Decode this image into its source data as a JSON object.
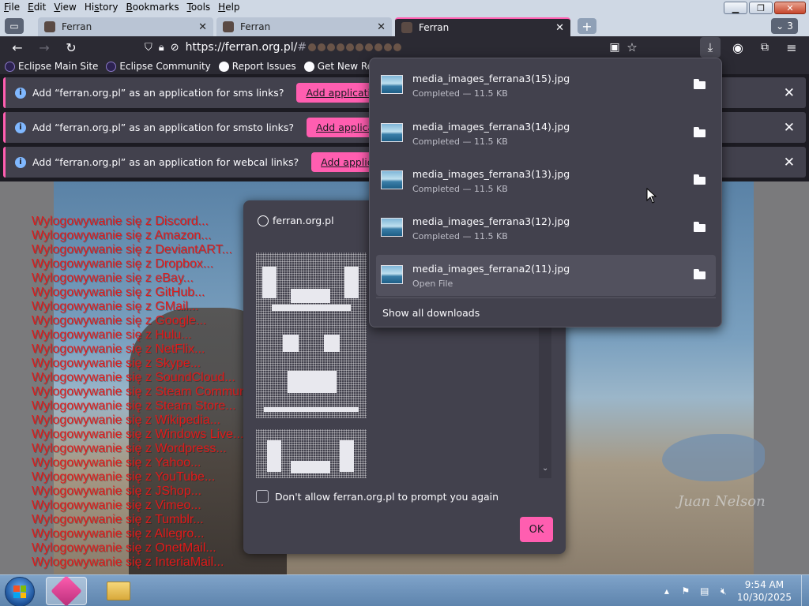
{
  "menubar": [
    {
      "pre": "",
      "u": "F",
      "post": "ile"
    },
    {
      "pre": "",
      "u": "E",
      "post": "dit"
    },
    {
      "pre": "",
      "u": "V",
      "post": "iew"
    },
    {
      "pre": "Hi",
      "u": "s",
      "post": "tory"
    },
    {
      "pre": "",
      "u": "B",
      "post": "ookmarks"
    },
    {
      "pre": "",
      "u": "T",
      "post": "ools"
    },
    {
      "pre": "",
      "u": "H",
      "post": "elp"
    }
  ],
  "tabs": [
    {
      "title": "Ferran",
      "close": "✕"
    },
    {
      "title": "Ferran",
      "close": "✕"
    },
    {
      "title": "Ferran",
      "close": "✕"
    }
  ],
  "tab_count": "3",
  "url": {
    "host": "https://ferran.org.pl/",
    "rest": "#"
  },
  "bookmarks": [
    "Eclipse Main Site",
    "Eclipse Community",
    "Report Issues",
    "Get New Releases"
  ],
  "notifications": [
    {
      "message": "Add “ferran.org.pl” as an application for sms links?",
      "button": "Add application"
    },
    {
      "message": "Add “ferran.org.pl” as an application for smsto links?",
      "button": "Add application"
    },
    {
      "message": "Add “ferran.org.pl” as an application for webcal links?",
      "button": "Add application"
    }
  ],
  "logout_lines": [
    "Wylogowywanie się z Discord...",
    "Wylogowywanie się z Amazon...",
    "Wylogowywanie się z DeviantART...",
    "Wylogowywanie się z Dropbox...",
    "Wylogowywanie się z eBay...",
    "Wylogowywanie się z GitHub...",
    "Wylogowywanie się z GMail...",
    "Wylogowywanie się z Google...",
    "Wylogowywanie się z Hulu...",
    "Wylogowywanie się z NetFlix...",
    "Wylogowywanie się z Skype...",
    "Wylogowywanie się z SoundCloud...",
    "Wylogowywanie się z Steam Commun",
    "Wylogowywanie się z Steam Store...",
    "Wylogowywanie się z Wikipedia...",
    "Wylogowywanie się z Windows Live...",
    "Wylogowywanie się z Wordpress...",
    "Wylogowywanie się z Yahoo...",
    "Wylogowywanie się z YouTube...",
    "Wylogowywanie się z JShop...",
    "Wylogowywanie się z Vimeo...",
    "Wylogowywanie się z Tumblr...",
    "Wylogowywanie się z Allegro...",
    "Wylogowywanie się z OnetMail...",
    "Wylogowywanie się z InteriaMail..."
  ],
  "watermark": "Juan Nelson",
  "dialog": {
    "origin": "ferran.org.pl",
    "checkbox_label": "Don't allow ferran.org.pl to prompt you again",
    "ok": "OK"
  },
  "downloads": {
    "items": [
      {
        "name": "media_images_ferrana3(15).jpg",
        "status": "Completed — 11.5 KB"
      },
      {
        "name": "media_images_ferrana3(14).jpg",
        "status": "Completed — 11.5 KB"
      },
      {
        "name": "media_images_ferrana3(13).jpg",
        "status": "Completed — 11.5 KB"
      },
      {
        "name": "media_images_ferrana3(12).jpg",
        "status": "Completed — 11.5 KB"
      },
      {
        "name": "media_images_ferrana2(11).jpg",
        "status": "Open File"
      }
    ],
    "show_all": "Show all downloads"
  },
  "taskbar": {
    "time": "9:54 AM",
    "date": "10/30/2025"
  },
  "colors": {
    "accent": "#ff5eb0",
    "panel": "#42414d",
    "logout_text": "#e01a1a"
  }
}
